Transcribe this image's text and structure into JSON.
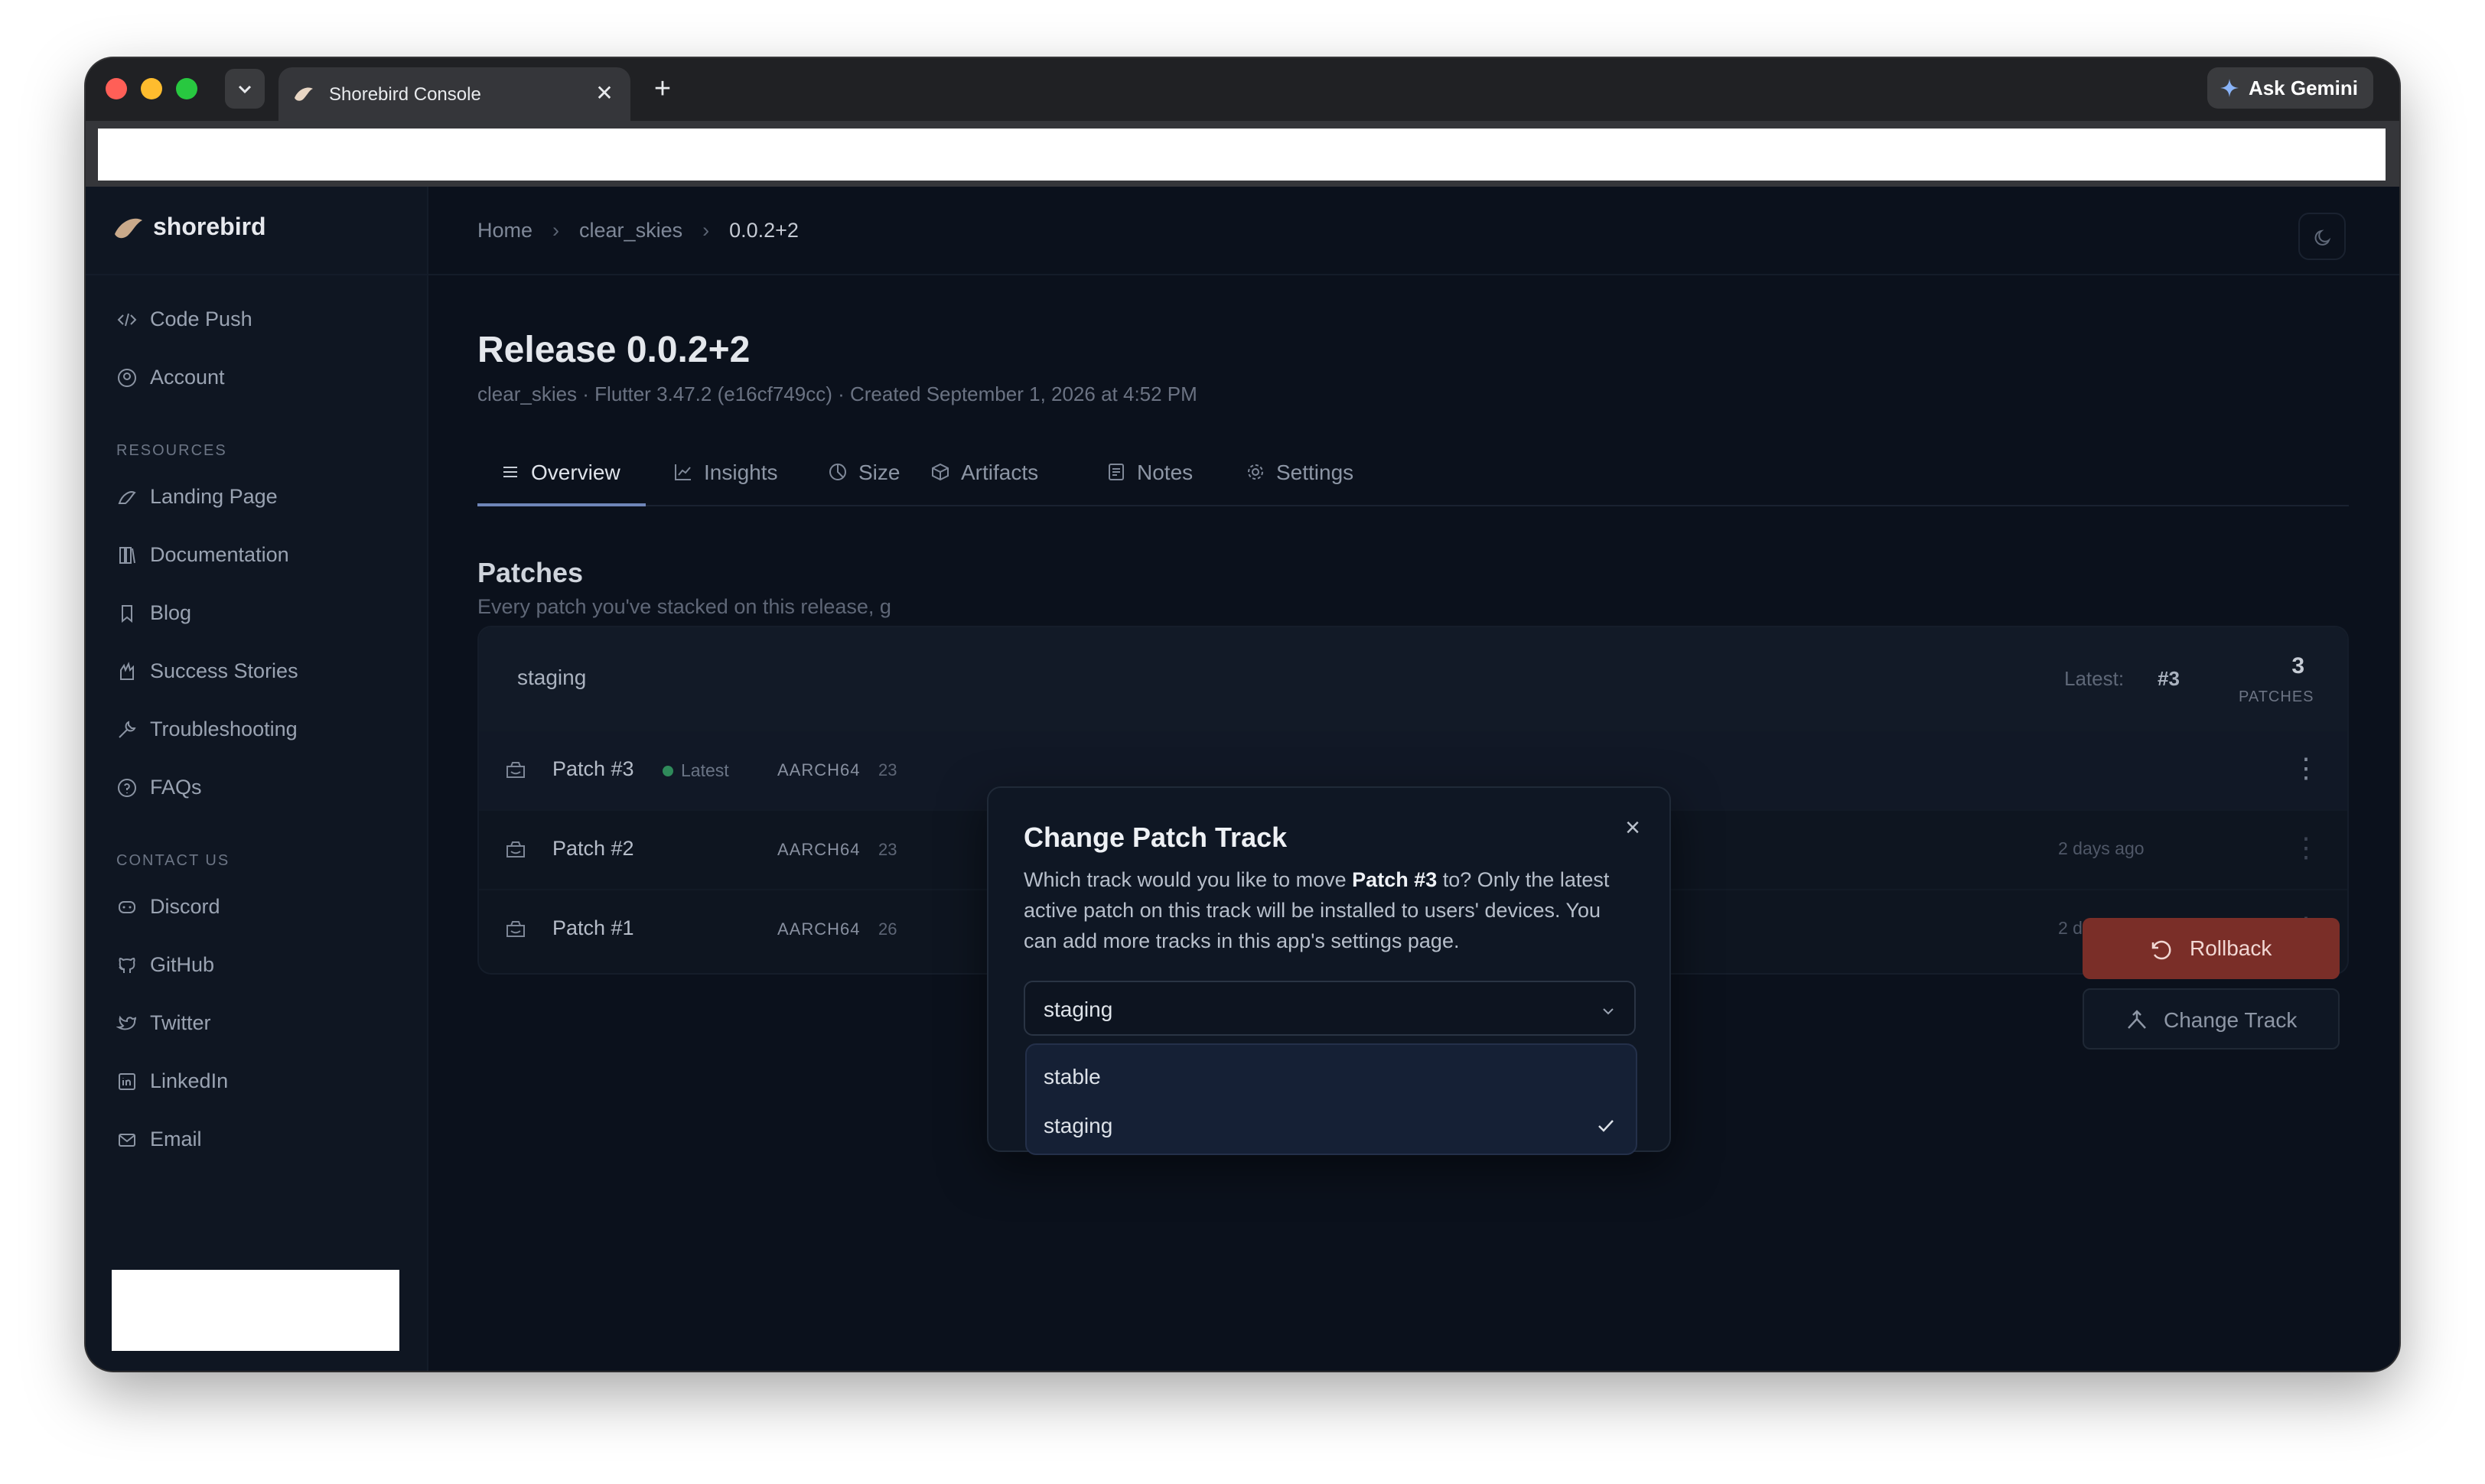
{
  "browser": {
    "tab_title": "Shorebird Console",
    "tab_close": "✕",
    "new_tab": "+",
    "gemini_label": "Ask Gemini"
  },
  "sidebar": {
    "brand": "shorebird",
    "items": [
      {
        "label": "Code Push",
        "icon": "code-icon"
      },
      {
        "label": "Account",
        "icon": "account-icon"
      }
    ],
    "resources_label": "RESOURCES",
    "resources": [
      {
        "label": "Landing Page",
        "icon": "bird-icon"
      },
      {
        "label": "Documentation",
        "icon": "book-icon"
      },
      {
        "label": "Blog",
        "icon": "bookmark-icon"
      },
      {
        "label": "Success Stories",
        "icon": "hands-icon"
      },
      {
        "label": "Troubleshooting",
        "icon": "wrench-icon"
      },
      {
        "label": "FAQs",
        "icon": "help-icon"
      }
    ],
    "contact_label": "CONTACT US",
    "contact": [
      {
        "label": "Discord",
        "icon": "discord-icon"
      },
      {
        "label": "GitHub",
        "icon": "github-icon"
      },
      {
        "label": "Twitter",
        "icon": "twitter-icon"
      },
      {
        "label": "LinkedIn",
        "icon": "linkedin-icon"
      },
      {
        "label": "Email",
        "icon": "mail-icon"
      }
    ]
  },
  "breadcrumb": {
    "home": "Home",
    "app": "clear_skies",
    "release": "0.0.2+2"
  },
  "release": {
    "title": "Release 0.0.2+2",
    "subtitle": "clear_skies · Flutter 3.47.2 (e16cf749cc) · Created September 1, 2026 at 4:52 PM"
  },
  "tabs": [
    {
      "label": "Overview",
      "icon": "list-icon",
      "active": true
    },
    {
      "label": "Insights",
      "icon": "chart-icon"
    },
    {
      "label": "Size",
      "icon": "pie-icon"
    },
    {
      "label": "Artifacts",
      "icon": "box-icon"
    },
    {
      "label": "Notes",
      "icon": "notes-icon"
    },
    {
      "label": "Settings",
      "icon": "gear-icon"
    }
  ],
  "patches": {
    "title": "Patches",
    "subtitle": "Every patch you've stacked on this release, g",
    "track": "staging",
    "latest_label": "Latest:",
    "latest_value": "#3",
    "count": "3",
    "count_label": "PATCHES",
    "rows": [
      {
        "name": "Patch #3",
        "badge": "Latest",
        "arch": "AARCH64",
        "size": "23",
        "time": ""
      },
      {
        "name": "Patch #2",
        "arch": "AARCH64",
        "size": "23",
        "time": "2 days ago"
      },
      {
        "name": "Patch #1",
        "arch": "AARCH64",
        "size": "26",
        "time": "2 days ago"
      }
    ]
  },
  "context_menu": {
    "rollback": "Rollback",
    "change_track": "Change Track"
  },
  "modal": {
    "title": "Change Patch Track",
    "body_pre": "Which track would you like to move ",
    "body_bold": "Patch #3",
    "body_post": " to? Only the latest active patch on this track will be installed to users' devices. You can add more tracks in this app's settings page.",
    "selected": "staging",
    "options": [
      "stable",
      "staging"
    ]
  },
  "colors": {
    "accent": "#6f86b8",
    "rollback": "#7a2e28",
    "latest_dot": "#2f8a5a"
  }
}
